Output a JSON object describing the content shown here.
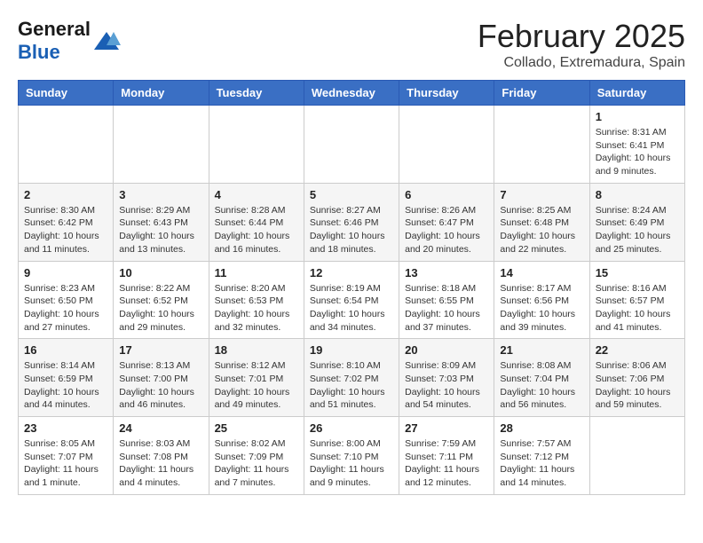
{
  "header": {
    "logo_general": "General",
    "logo_blue": "Blue",
    "month_title": "February 2025",
    "location": "Collado, Extremadura, Spain"
  },
  "weekdays": [
    "Sunday",
    "Monday",
    "Tuesday",
    "Wednesday",
    "Thursday",
    "Friday",
    "Saturday"
  ],
  "weeks": [
    [
      {
        "day": null
      },
      {
        "day": null
      },
      {
        "day": null
      },
      {
        "day": null
      },
      {
        "day": null
      },
      {
        "day": null
      },
      {
        "day": "1",
        "sunrise": "8:31 AM",
        "sunset": "6:41 PM",
        "daylight": "10 hours and 9 minutes."
      }
    ],
    [
      {
        "day": "2",
        "sunrise": "8:30 AM",
        "sunset": "6:42 PM",
        "daylight": "10 hours and 11 minutes."
      },
      {
        "day": "3",
        "sunrise": "8:29 AM",
        "sunset": "6:43 PM",
        "daylight": "10 hours and 13 minutes."
      },
      {
        "day": "4",
        "sunrise": "8:28 AM",
        "sunset": "6:44 PM",
        "daylight": "10 hours and 16 minutes."
      },
      {
        "day": "5",
        "sunrise": "8:27 AM",
        "sunset": "6:46 PM",
        "daylight": "10 hours and 18 minutes."
      },
      {
        "day": "6",
        "sunrise": "8:26 AM",
        "sunset": "6:47 PM",
        "daylight": "10 hours and 20 minutes."
      },
      {
        "day": "7",
        "sunrise": "8:25 AM",
        "sunset": "6:48 PM",
        "daylight": "10 hours and 22 minutes."
      },
      {
        "day": "8",
        "sunrise": "8:24 AM",
        "sunset": "6:49 PM",
        "daylight": "10 hours and 25 minutes."
      }
    ],
    [
      {
        "day": "9",
        "sunrise": "8:23 AM",
        "sunset": "6:50 PM",
        "daylight": "10 hours and 27 minutes."
      },
      {
        "day": "10",
        "sunrise": "8:22 AM",
        "sunset": "6:52 PM",
        "daylight": "10 hours and 29 minutes."
      },
      {
        "day": "11",
        "sunrise": "8:20 AM",
        "sunset": "6:53 PM",
        "daylight": "10 hours and 32 minutes."
      },
      {
        "day": "12",
        "sunrise": "8:19 AM",
        "sunset": "6:54 PM",
        "daylight": "10 hours and 34 minutes."
      },
      {
        "day": "13",
        "sunrise": "8:18 AM",
        "sunset": "6:55 PM",
        "daylight": "10 hours and 37 minutes."
      },
      {
        "day": "14",
        "sunrise": "8:17 AM",
        "sunset": "6:56 PM",
        "daylight": "10 hours and 39 minutes."
      },
      {
        "day": "15",
        "sunrise": "8:16 AM",
        "sunset": "6:57 PM",
        "daylight": "10 hours and 41 minutes."
      }
    ],
    [
      {
        "day": "16",
        "sunrise": "8:14 AM",
        "sunset": "6:59 PM",
        "daylight": "10 hours and 44 minutes."
      },
      {
        "day": "17",
        "sunrise": "8:13 AM",
        "sunset": "7:00 PM",
        "daylight": "10 hours and 46 minutes."
      },
      {
        "day": "18",
        "sunrise": "8:12 AM",
        "sunset": "7:01 PM",
        "daylight": "10 hours and 49 minutes."
      },
      {
        "day": "19",
        "sunrise": "8:10 AM",
        "sunset": "7:02 PM",
        "daylight": "10 hours and 51 minutes."
      },
      {
        "day": "20",
        "sunrise": "8:09 AM",
        "sunset": "7:03 PM",
        "daylight": "10 hours and 54 minutes."
      },
      {
        "day": "21",
        "sunrise": "8:08 AM",
        "sunset": "7:04 PM",
        "daylight": "10 hours and 56 minutes."
      },
      {
        "day": "22",
        "sunrise": "8:06 AM",
        "sunset": "7:06 PM",
        "daylight": "10 hours and 59 minutes."
      }
    ],
    [
      {
        "day": "23",
        "sunrise": "8:05 AM",
        "sunset": "7:07 PM",
        "daylight": "11 hours and 1 minute."
      },
      {
        "day": "24",
        "sunrise": "8:03 AM",
        "sunset": "7:08 PM",
        "daylight": "11 hours and 4 minutes."
      },
      {
        "day": "25",
        "sunrise": "8:02 AM",
        "sunset": "7:09 PM",
        "daylight": "11 hours and 7 minutes."
      },
      {
        "day": "26",
        "sunrise": "8:00 AM",
        "sunset": "7:10 PM",
        "daylight": "11 hours and 9 minutes."
      },
      {
        "day": "27",
        "sunrise": "7:59 AM",
        "sunset": "7:11 PM",
        "daylight": "11 hours and 12 minutes."
      },
      {
        "day": "28",
        "sunrise": "7:57 AM",
        "sunset": "7:12 PM",
        "daylight": "11 hours and 14 minutes."
      },
      {
        "day": null
      }
    ]
  ]
}
